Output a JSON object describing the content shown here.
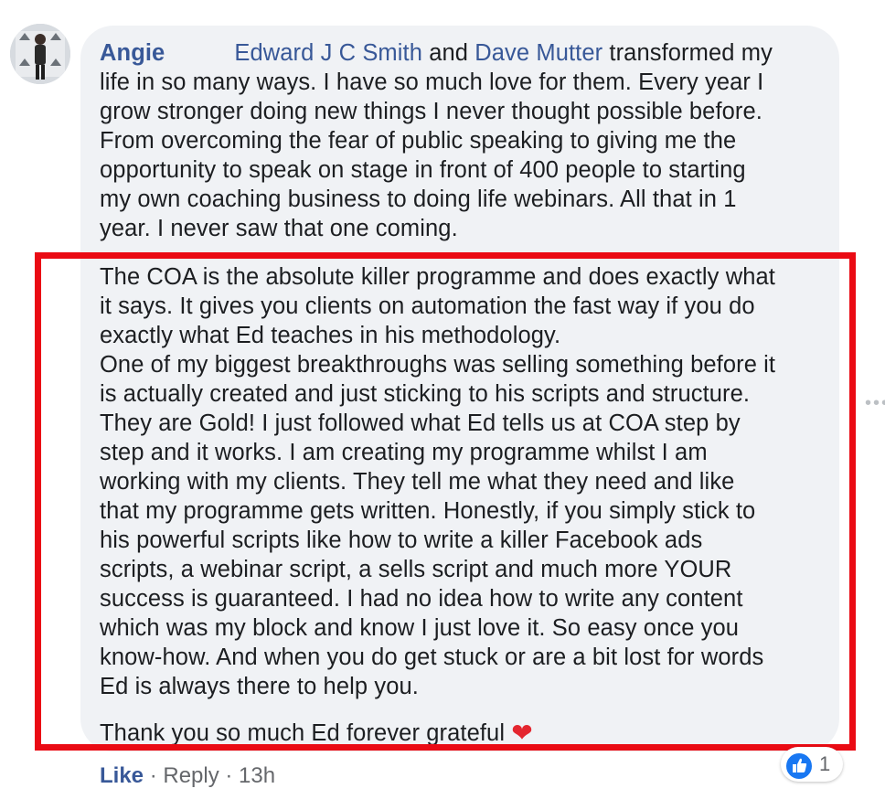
{
  "comment": {
    "author": "Angie",
    "mention_1": "Edward J C Smith",
    "connector": " and ",
    "mention_2": "Dave Mutter",
    "intro_rest": " transformed my\nlife in so many ways. I have so much love for them. Every year I\ngrow stronger doing new things I never thought possible before.\nFrom overcoming the fear of public speaking to giving me the\nopportunity to speak on stage in front of 400 people to starting\nmy own coaching business to doing life webinars. All that in 1\nyear. I never saw that one coming.",
    "highlighted_text": "The COA is the absolute killer programme and does exactly what\nit says. It gives you clients on automation the fast way if you do\nexactly what Ed teaches in his methodology.\nOne of my biggest breakthroughs was selling something before it\nis actually created and just sticking to his scripts and structure.\nThey are Gold! I just followed what Ed tells us at COA step by\nstep and it works. I am creating my programme whilst I am\nworking with my clients. They tell me what they need and like\nthat my programme gets written. Honestly, if you simply stick to\nhis powerful scripts like how to write a killer Facebook ads\nscripts, a webinar script, a sells script and much more YOUR\nsuccess is guaranteed. I had no idea how to write any content\nwhich was my block and know I just love it. So easy once you\nknow-how. And when you do get stuck or are a bit lost for words\nEd is always there to help you.",
    "closing": "Thank you so much Ed forever grateful ",
    "closing_emoji": "❤"
  },
  "actions": {
    "like": "Like",
    "separator_1": " · ",
    "reply": "Reply",
    "separator_2": " · ",
    "time": "13h"
  },
  "reaction": {
    "icon": "like-icon",
    "count": "1"
  },
  "colors": {
    "highlight_border": "#ea0b14",
    "link": "#385898",
    "bubble_bg": "#f0f2f5"
  }
}
